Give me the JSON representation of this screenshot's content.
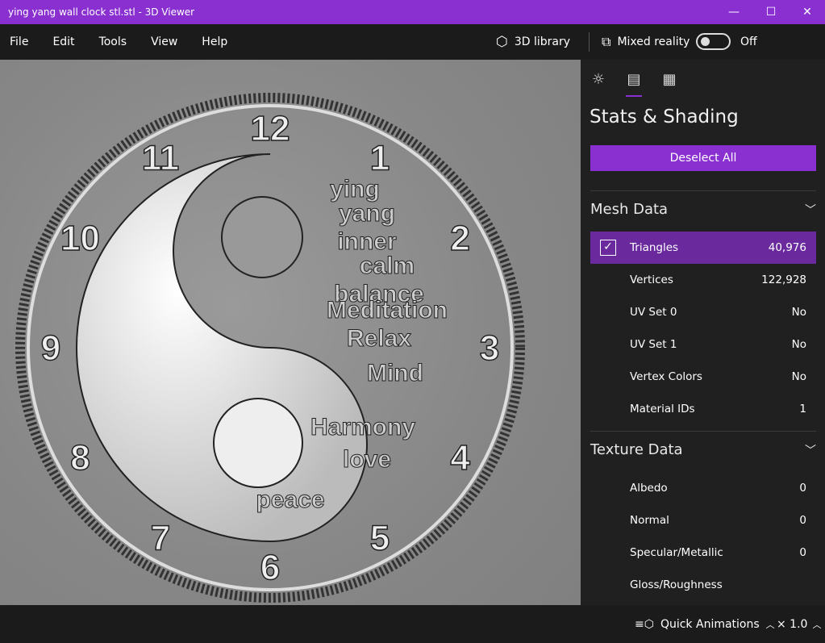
{
  "window": {
    "title": "ying yang wall clock stl.stl - 3D Viewer",
    "minimize": "—",
    "maximize": "☐",
    "close": "✕"
  },
  "menu": [
    "File",
    "Edit",
    "Tools",
    "View",
    "Help"
  ],
  "toolbar": {
    "library": "3D library",
    "mixed_reality": "Mixed reality",
    "toggle_state": "Off"
  },
  "model": {
    "numbers": [
      "12",
      "1",
      "2",
      "3",
      "4",
      "5",
      "6",
      "7",
      "8",
      "9",
      "10",
      "11"
    ],
    "words": [
      "ying",
      "yang",
      "inner",
      "calm",
      "balance",
      "Meditation",
      "Relax",
      "Mind",
      "Harmony",
      "love",
      "peace"
    ]
  },
  "panel": {
    "title": "Stats & Shading",
    "deselect": "Deselect All",
    "mesh_title": "Mesh Data",
    "mesh": [
      {
        "label": "Triangles",
        "value": "40,976",
        "checked": true
      },
      {
        "label": "Vertices",
        "value": "122,928"
      },
      {
        "label": "UV Set 0",
        "value": "No"
      },
      {
        "label": "UV Set 1",
        "value": "No"
      },
      {
        "label": "Vertex Colors",
        "value": "No"
      },
      {
        "label": "Material IDs",
        "value": "1"
      }
    ],
    "texture_title": "Texture Data",
    "texture": [
      {
        "label": "Albedo",
        "value": "0"
      },
      {
        "label": "Normal",
        "value": "0"
      },
      {
        "label": "Specular/Metallic",
        "value": "0"
      },
      {
        "label": "Gloss/Roughness",
        "value": ""
      }
    ]
  },
  "status": {
    "animations": "Quick Animations",
    "speed": "× 1.0"
  },
  "colors": {
    "accent": "#8a2fd0"
  }
}
